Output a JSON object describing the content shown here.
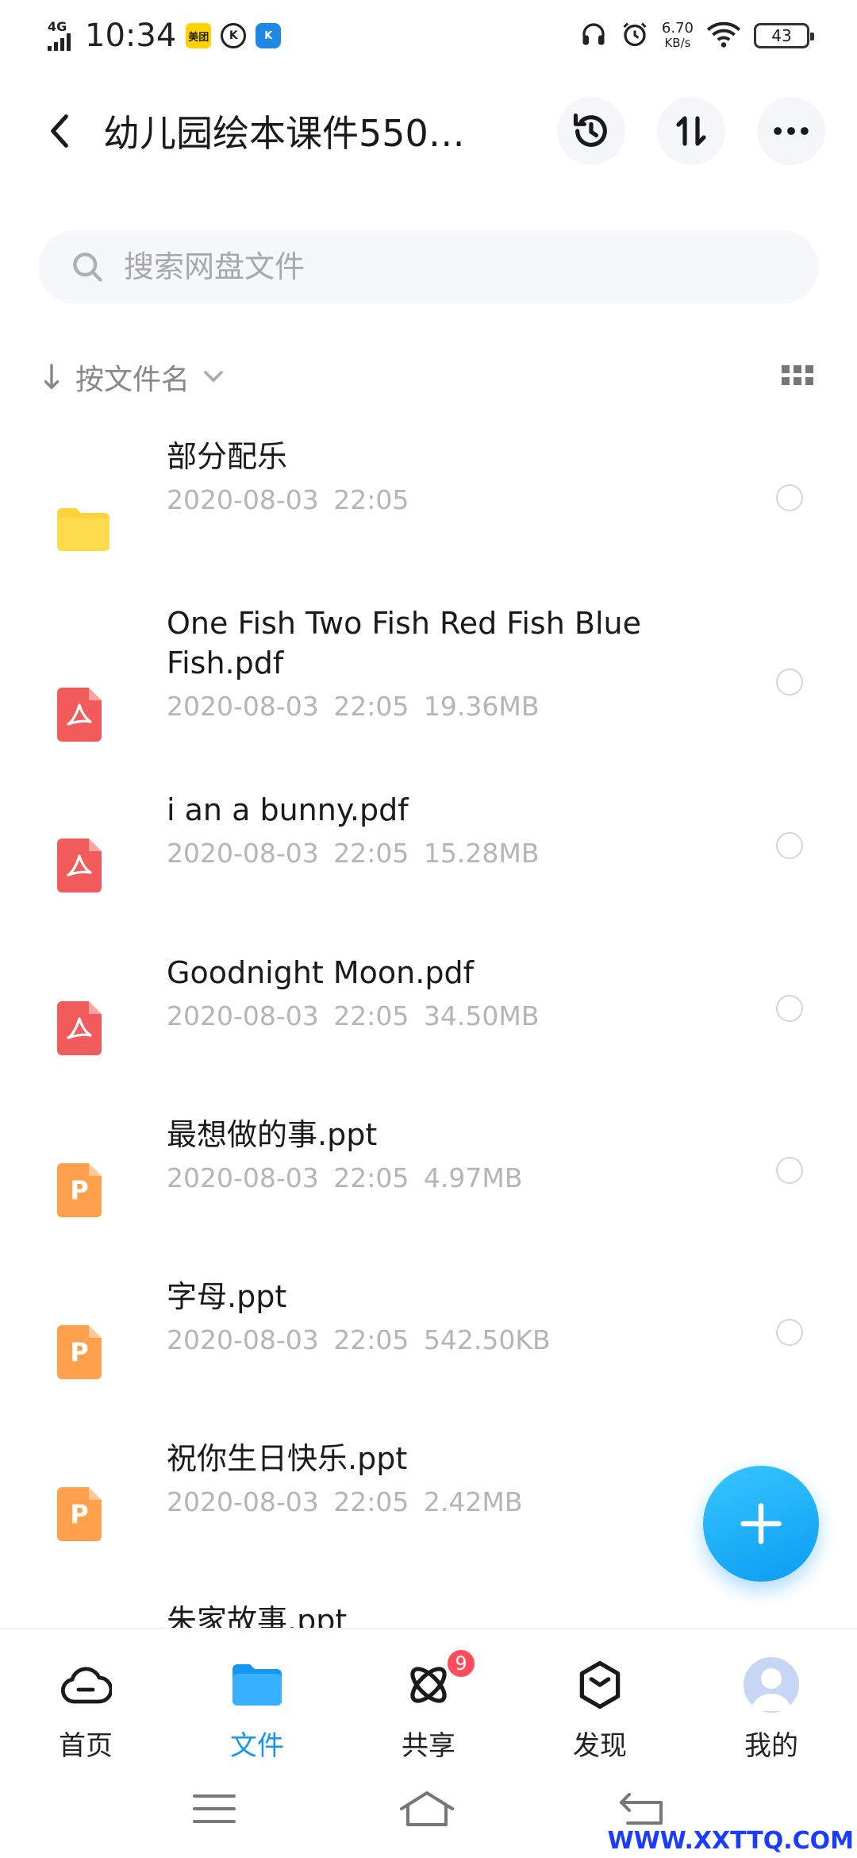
{
  "status_bar": {
    "network": "4G",
    "time": "10:34",
    "app_badges": [
      "美团",
      "K",
      "K"
    ],
    "speed_value": "6.70",
    "speed_unit": "KB/s",
    "battery": "43"
  },
  "header": {
    "title": "幼儿园绘本课件550…",
    "icons": [
      "back-arrow-icon",
      "history-icon",
      "transfer-icon",
      "more-icon"
    ]
  },
  "search": {
    "placeholder": "搜索网盘文件"
  },
  "sort": {
    "label": "按文件名"
  },
  "files": [
    {
      "name": "部分配乐",
      "date": "2020-08-03",
      "time": "22:05",
      "size": "",
      "type": "folder"
    },
    {
      "name": "One Fish Two Fish Red Fish Blue Fish.pdf",
      "date": "2020-08-03",
      "time": "22:05",
      "size": "19.36MB",
      "type": "pdf"
    },
    {
      "name": "i an a bunny.pdf",
      "date": "2020-08-03",
      "time": "22:05",
      "size": "15.28MB",
      "type": "pdf"
    },
    {
      "name": "Goodnight Moon.pdf",
      "date": "2020-08-03",
      "time": "22:05",
      "size": "34.50MB",
      "type": "pdf"
    },
    {
      "name": "最想做的事.ppt",
      "date": "2020-08-03",
      "time": "22:05",
      "size": "4.97MB",
      "type": "ppt"
    },
    {
      "name": "字母.ppt",
      "date": "2020-08-03",
      "time": "22:05",
      "size": "542.50KB",
      "type": "ppt"
    },
    {
      "name": "祝你生日快乐.ppt",
      "date": "2020-08-03",
      "time": "22:05",
      "size": "2.42MB",
      "type": "ppt"
    },
    {
      "name": "朱家故事.ppt",
      "date": "",
      "time": "",
      "size": "",
      "type": "ppt"
    }
  ],
  "ppt_letter": "P",
  "nav": {
    "items": [
      {
        "label": "首页",
        "icon": "cloud-icon"
      },
      {
        "label": "文件",
        "icon": "folder-icon"
      },
      {
        "label": "共享",
        "icon": "atom-icon"
      },
      {
        "label": "发现",
        "icon": "cube-icon"
      },
      {
        "label": "我的",
        "icon": "avatar"
      }
    ],
    "share_badge": "9"
  },
  "colors": {
    "accent": "#1597ef",
    "pdf": "#f25b5b",
    "ppt": "#ffa04d",
    "folder": "#ffd43b",
    "badge": "#ff4d5e"
  },
  "watermark": "WWW.XXTTQ.COM"
}
